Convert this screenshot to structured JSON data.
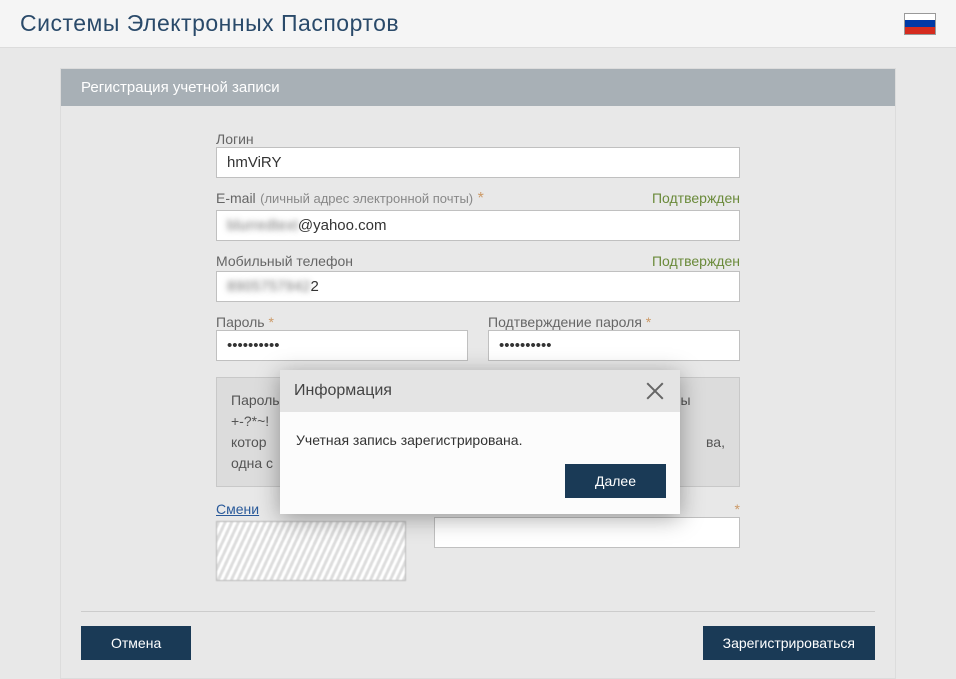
{
  "header": {
    "title": "Системы Электронных Паспортов",
    "flag": "russia-flag"
  },
  "panel": {
    "title": "Регистрация учетной записи"
  },
  "form": {
    "login_label": "Логин",
    "login_value": "hmViRY",
    "email_label": "E-mail",
    "email_sub": "(личный адрес электронной почты)",
    "email_value": "@yahoo.com",
    "email_status": "Подтвержден",
    "phone_label": "Мобильный телефон",
    "phone_value": "2",
    "phone_status": "Подтвержден",
    "password_label": "Пароль",
    "password_value": "••••••••••",
    "password_confirm_label": "Подтверждение пароля",
    "password_confirm_value": "••••••••••",
    "password_hint_line1": "Пароль должен содержать только латинские буквы, цифры и символы",
    "password_hint_line2": "+-?*~!",
    "password_hint_line3": "котор",
    "password_hint_line4": "одна с",
    "password_hint_tail": "ва,",
    "captcha_change": "Смени",
    "captcha_input_tail": "*"
  },
  "buttons": {
    "cancel": "Отмена",
    "register": "Зарегистрироваться"
  },
  "modal": {
    "title": "Информация",
    "message": "Учетная запись зарегистрирована.",
    "next": "Далее"
  }
}
